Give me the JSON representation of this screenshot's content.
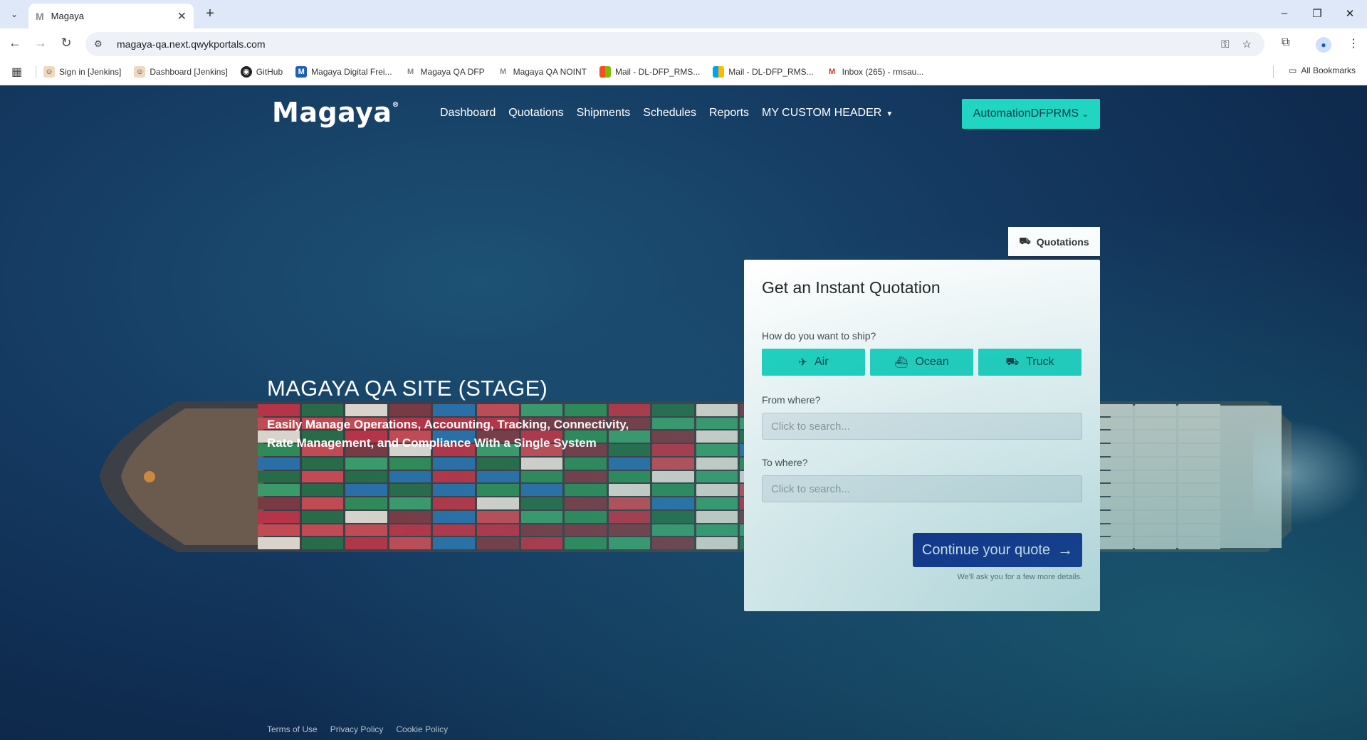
{
  "browser": {
    "tab_title": "Magaya",
    "tab_favicon": "M",
    "url": "magaya-qa.next.qwykportals.com",
    "bookmarks": [
      {
        "label": "Sign in [Jenkins]",
        "icon": "jenkins-icon"
      },
      {
        "label": "Dashboard [Jenkins]",
        "icon": "jenkins-icon"
      },
      {
        "label": "GitHub",
        "icon": "github-icon"
      },
      {
        "label": "Magaya Digital Frei...",
        "icon": "magaya-icon"
      },
      {
        "label": "Magaya QA DFP",
        "icon": "magaya-gray-icon"
      },
      {
        "label": "Magaya QA NOINT",
        "icon": "magaya-gray-icon"
      },
      {
        "label": "Mail - DL-DFP_RMS...",
        "icon": "microsoft-icon"
      },
      {
        "label": "Mail - DL-DFP_RMS...",
        "icon": "microsoft-icon"
      },
      {
        "label": "Inbox (265) - rmsau...",
        "icon": "gmail-icon"
      }
    ],
    "all_bookmarks_label": "All Bookmarks"
  },
  "header": {
    "logo": "Magaya",
    "logo_mark": "®",
    "nav": [
      "Dashboard",
      "Quotations",
      "Shipments",
      "Schedules",
      "Reports",
      "MY CUSTOM HEADER"
    ],
    "user_button": "AutomationDFPRMS"
  },
  "hero": {
    "title": "MAGAYA QA SITE (STAGE)",
    "subtitle": "Easily Manage Operations, Accounting, Tracking, Connectivity, Rate Management, and Compliance With a Single System"
  },
  "quote": {
    "tab_label": "Quotations",
    "title": "Get an Instant Quotation",
    "ship_question": "How do you want to ship?",
    "modes": [
      {
        "label": "Air",
        "icon": "airplane-icon"
      },
      {
        "label": "Ocean",
        "icon": "ship-icon"
      },
      {
        "label": "Truck",
        "icon": "truck-icon"
      }
    ],
    "from_label": "From where?",
    "from_placeholder": "Click to search...",
    "to_label": "To where?",
    "to_placeholder": "Click to search...",
    "continue_label": "Continue your quote",
    "continue_note": "We'll ask you for a few more details."
  },
  "footer": [
    "Terms of Use",
    "Privacy Policy",
    "Cookie Policy"
  ],
  "colors": {
    "accent": "#20d5c1",
    "primary_button": "#0c1a87",
    "background": "#153a62"
  }
}
